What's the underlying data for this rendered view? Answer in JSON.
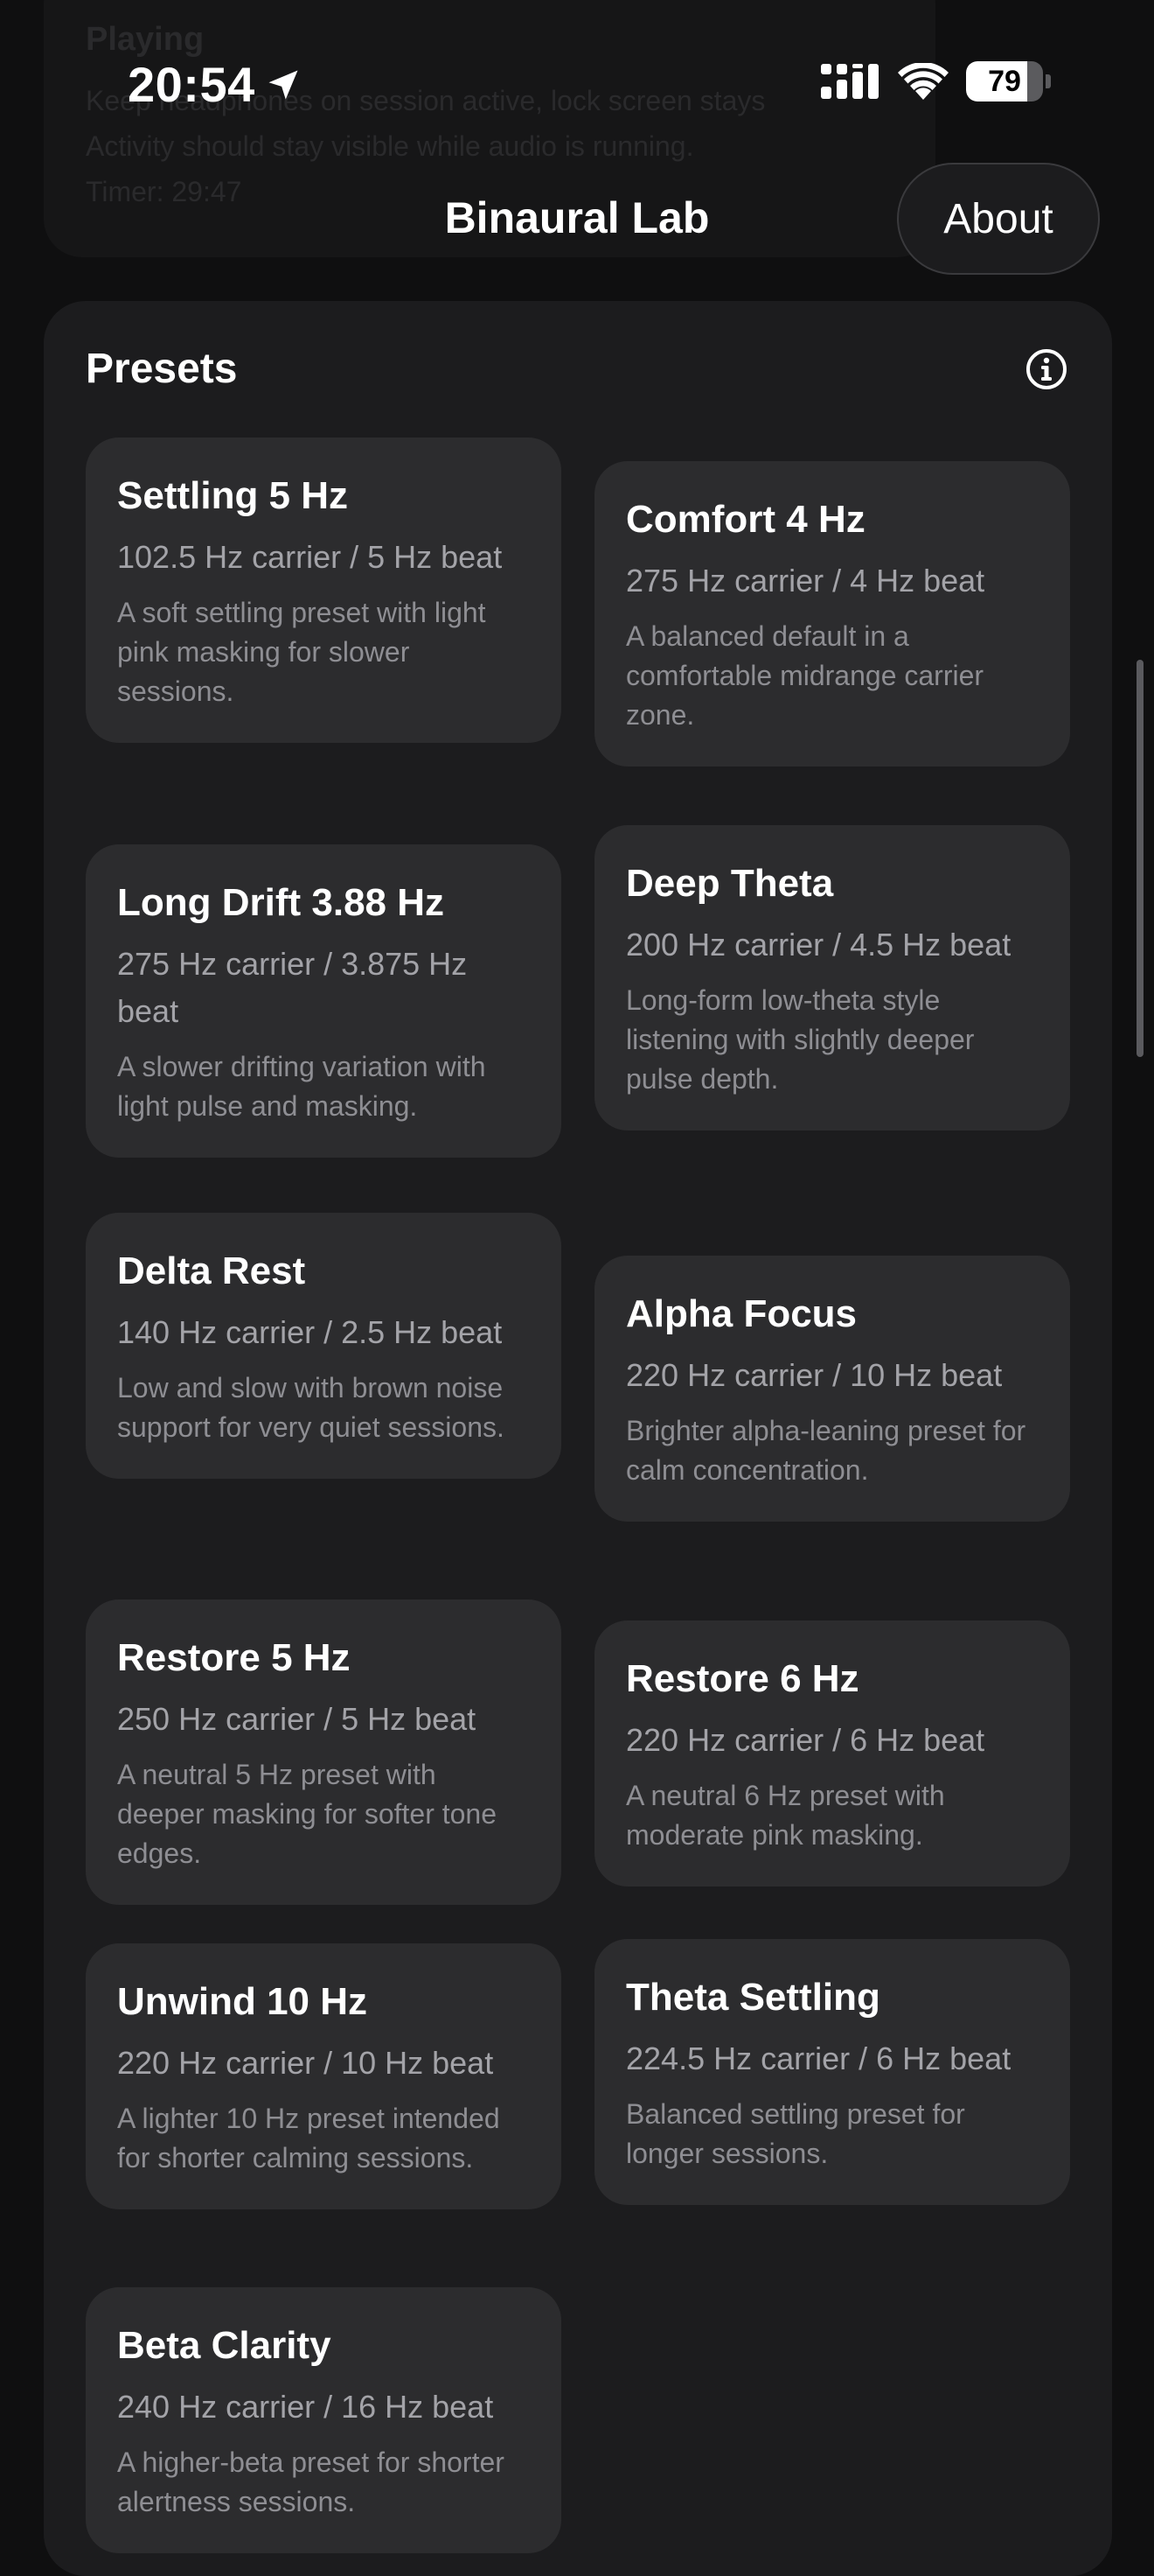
{
  "background_card": {
    "title": "Playing",
    "line1": "Keep headphones on session active, lock screen stays",
    "line2": "Activity should stay visible while audio is running.",
    "line3": "Timer: 29:47"
  },
  "status_bar": {
    "time": "20:54",
    "battery_percent": 79,
    "battery_label": "79",
    "location_icon": "location-arrow-icon",
    "signal_icon": "cellular-signal-icon",
    "wifi_icon": "wifi-icon"
  },
  "header": {
    "title": "Binaural Lab",
    "about_label": "About"
  },
  "presets": {
    "title": "Presets",
    "info_icon": "info-circle-icon",
    "items": [
      {
        "title": "Settling 5 Hz",
        "subtitle": "102.5 Hz carrier / 5 Hz beat",
        "description": "A soft settling preset with light pink masking for slower sessions."
      },
      {
        "title": "Comfort 4 Hz",
        "subtitle": "275 Hz carrier / 4 Hz beat",
        "description": "A balanced default in a comfortable midrange carrier zone."
      },
      {
        "title": "Long Drift 3.88 Hz",
        "subtitle": "275 Hz carrier / 3.875 Hz beat",
        "description": "A slower drifting variation with light pulse and masking."
      },
      {
        "title": "Deep Theta",
        "subtitle": "200 Hz carrier / 4.5 Hz beat",
        "description": "Long-form low-theta style listening with slightly deeper pulse depth."
      },
      {
        "title": "Delta Rest",
        "subtitle": "140 Hz carrier / 2.5 Hz beat",
        "description": "Low and slow with brown noise support for very quiet sessions."
      },
      {
        "title": "Alpha Focus",
        "subtitle": "220 Hz carrier / 10 Hz beat",
        "description": "Brighter alpha-leaning preset for calm concentration."
      },
      {
        "title": "Restore 5 Hz",
        "subtitle": "250 Hz carrier / 5 Hz beat",
        "description": "A neutral 5 Hz preset with deeper masking for softer tone edges."
      },
      {
        "title": "Restore 6 Hz",
        "subtitle": "220 Hz carrier / 6 Hz beat",
        "description": "A neutral 6 Hz preset with moderate pink masking."
      },
      {
        "title": "Unwind 10 Hz",
        "subtitle": "220 Hz carrier / 10 Hz beat",
        "description": "A lighter 10 Hz preset intended for shorter calming sessions."
      },
      {
        "title": "Theta Settling",
        "subtitle": "224.5 Hz carrier / 6 Hz beat",
        "description": "Balanced settling preset for longer sessions."
      },
      {
        "title": "Beta Clarity",
        "subtitle": "240 Hz carrier / 16 Hz beat",
        "description": "A higher-beta preset for shorter alertness sessions."
      }
    ]
  },
  "colors": {
    "background": "#0f0f10",
    "panel": "#1c1c1e",
    "card": "#2c2c2e",
    "text_primary": "#ffffff",
    "text_secondary": "#a3a3a8",
    "text_tertiary": "#8e8e93"
  }
}
